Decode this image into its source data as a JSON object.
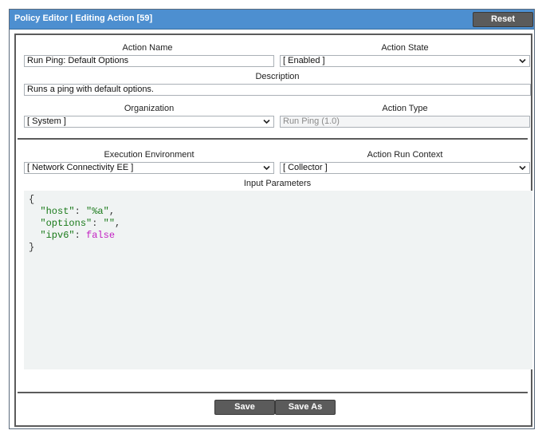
{
  "window": {
    "title": "Policy Editor | Editing Action [59]",
    "reset_label": "Reset"
  },
  "form": {
    "action_name": {
      "label": "Action Name",
      "value": "Run Ping: Default Options"
    },
    "action_state": {
      "label": "Action State",
      "value": "[ Enabled ]"
    },
    "description": {
      "label": "Description",
      "value": "Runs a ping with default options."
    },
    "organization": {
      "label": "Organization",
      "value": "[ System ]"
    },
    "action_type": {
      "label": "Action Type",
      "value": "Run Ping (1.0)"
    },
    "execution_environment": {
      "label": "Execution Environment",
      "value": "[ Network Connectivity EE ]"
    },
    "action_run_context": {
      "label": "Action Run Context",
      "value": "[ Collector ]"
    },
    "input_parameters": {
      "label": "Input Parameters",
      "open_brace": "{",
      "close_brace": "}",
      "lines": [
        {
          "key": "\"host\"",
          "sep": ": ",
          "value": "\"%a\"",
          "end": ",",
          "kind": "string"
        },
        {
          "key": "\"options\"",
          "sep": ": ",
          "value": "\"\"",
          "end": ",",
          "kind": "string"
        },
        {
          "key": "\"ipv6\"",
          "sep": ": ",
          "value": "false",
          "end": "",
          "kind": "bool"
        }
      ]
    }
  },
  "buttons": {
    "save_label": "Save",
    "save_as_label": "Save As"
  },
  "colors": {
    "titlebar": "#4d8fd0",
    "button": "#5b5b5b",
    "code_bg": "#f0f3f3",
    "json_key": "#1a7a1a",
    "json_bool": "#c21fc2"
  }
}
